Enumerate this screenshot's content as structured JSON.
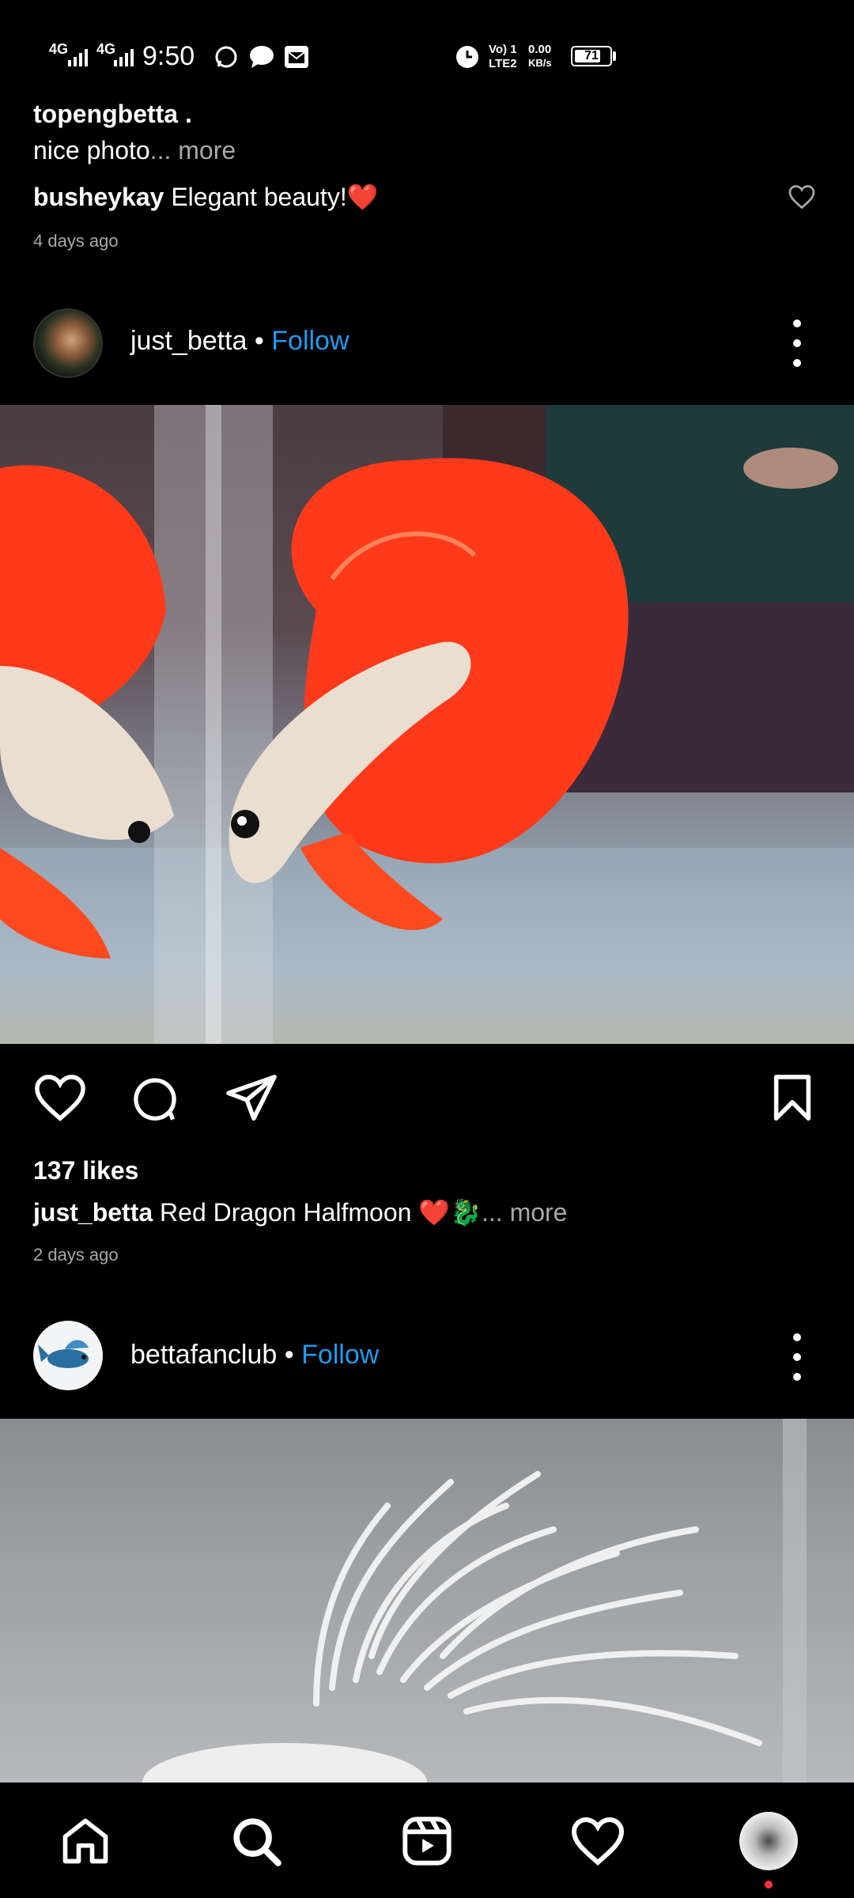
{
  "status_bar": {
    "net1": "4G",
    "net2": "4G",
    "time": "9:50",
    "volte": "Vo) 1",
    "lte": "LTE2",
    "speed_value": "0.00",
    "speed_unit": "KB/s",
    "battery": "71"
  },
  "comments": {
    "first_user": "topengbetta .",
    "first_text": "nice photo",
    "first_more": "... more",
    "second_user": "busheykay",
    "second_text": "Elegant beauty!❤️",
    "timestamp": "4 days ago"
  },
  "post1": {
    "username": "just_betta",
    "separator": "•",
    "follow_label": "Follow",
    "likes": "137 likes",
    "caption_user": "just_betta",
    "caption_text": "Red Dragon Halfmoon ❤️🐉",
    "caption_more": "... more",
    "timestamp": "2 days ago"
  },
  "post2": {
    "username": "bettafanclub",
    "separator": "•",
    "follow_label": "Follow"
  },
  "bottom_nav": {
    "items": [
      "home",
      "search",
      "reels",
      "activity",
      "profile"
    ]
  }
}
